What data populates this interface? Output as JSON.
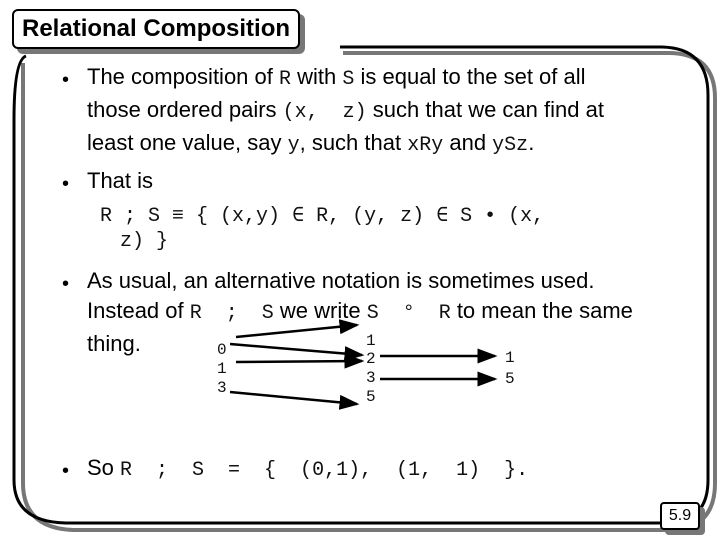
{
  "slide": {
    "title": "Relational Composition",
    "page_number": "5.9"
  },
  "bullets": [
    {
      "lines": [
        [
          {
            "t": "The composition of "
          },
          {
            "m": "R"
          },
          {
            "t": " with "
          },
          {
            "m": "S"
          },
          {
            "t": " is equal to the set of all"
          }
        ],
        [
          {
            "t": "those ordered pairs "
          },
          {
            "m": "(x,  z)"
          },
          {
            "t": " such that we can find at"
          }
        ],
        [
          {
            "t": "least one value, say "
          },
          {
            "m": "y"
          },
          {
            "t": ", such that "
          },
          {
            "m": "xRy"
          },
          {
            "t": " and "
          },
          {
            "m": "ySz"
          },
          {
            "t": "."
          }
        ]
      ]
    },
    {
      "lines": [
        [
          {
            "t": "That is"
          }
        ]
      ]
    },
    {
      "lines": [
        [
          {
            "t": "As usual, an alternative notation is sometimes used."
          }
        ],
        [
          {
            "t": "Instead of "
          },
          {
            "m": "R  ;  S"
          },
          {
            "t": " we write "
          },
          {
            "m": "S  °  R"
          },
          {
            "t": " to mean the same"
          }
        ],
        [
          {
            "t": "thing."
          }
        ]
      ]
    },
    {
      "lines": [
        [
          {
            "t": "So "
          },
          {
            "m": "R  ;  S  =  {  (0,1),  (1,  1)  }."
          }
        ]
      ]
    }
  ],
  "formula": {
    "line1": "R ; S ≡ { (x,y) ∈ R, (y, z) ∈ S • (x,",
    "line2": "z) }"
  },
  "diagram": {
    "domain": [
      "0",
      "1",
      "3"
    ],
    "middle": [
      "1",
      "2",
      "3",
      "5"
    ],
    "codomain": [
      "1",
      "5"
    ],
    "R_arrows": [
      [
        "0",
        "1"
      ],
      [
        "0",
        "2"
      ],
      [
        "1",
        "2"
      ],
      [
        "3",
        "5"
      ]
    ],
    "S_arrows": [
      [
        "2",
        "1"
      ],
      [
        "3",
        "5"
      ]
    ]
  }
}
